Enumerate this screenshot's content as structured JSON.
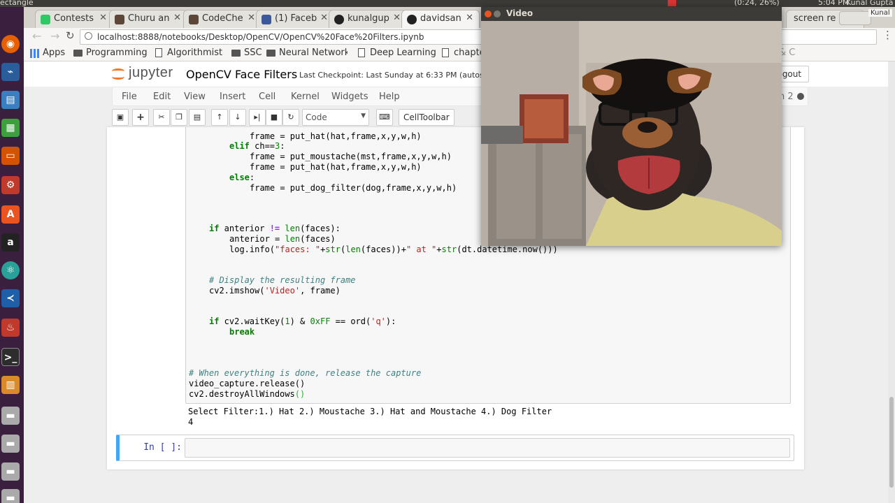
{
  "os": {
    "app_name": "ectangle",
    "tray": "(0:24, 26%)",
    "time": "5:04 PM",
    "user": "Kunal Gupta",
    "profile": "Kunal"
  },
  "browser": {
    "tabs": [
      {
        "label": "Contests",
        "icon_color": "#2ec866"
      },
      {
        "label": "Churu an",
        "icon_color": "#5b4638"
      },
      {
        "label": "CodeChe",
        "icon_color": "#5b4638"
      },
      {
        "label": "(1) Faceb",
        "icon_color": "#3b5998"
      },
      {
        "label": "kunalgup",
        "icon_color": "#222222"
      },
      {
        "label": "davidsan",
        "icon_color": "#222222"
      },
      {
        "label": "screen re",
        "icon_color": "#4a90d9"
      }
    ],
    "url": "localhost:8888/notebooks/Desktop/OpenCV/OpenCV%20Face%20Filters.ipynb",
    "bookmarks": [
      "Apps",
      "Programming",
      "Algorithmist",
      "SSC",
      "Neural Network",
      "Deep Learning",
      "chapte",
      "& C"
    ]
  },
  "jupyter": {
    "logo": "jupyter",
    "title": "OpenCV Face Filters",
    "checkpoint": "Last Checkpoint: Last Sunday at 6:33 PM (autosave",
    "logout": "Logout",
    "kernel": "n 2",
    "menu": [
      "File",
      "Edit",
      "View",
      "Insert",
      "Cell",
      "Kernel",
      "Widgets",
      "Help"
    ],
    "cell_type": "Code",
    "celltoolbar": "CellToolbar",
    "output_lines": [
      "Select Filter:1.) Hat 2.) Moustache 3.) Hat and Moustache 4.) Dog Filter",
      "4"
    ],
    "prompt": "In [ ]:"
  },
  "video": {
    "title": "Video"
  },
  "colors": {
    "launcher": "#3a1f3f",
    "jupyter_orange": "#f37726",
    "selected_cell": "#42a5f5"
  }
}
